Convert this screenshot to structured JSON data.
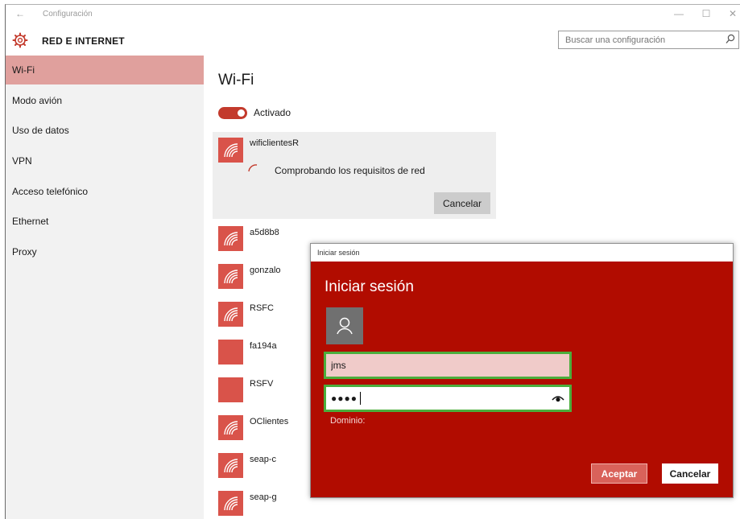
{
  "window": {
    "title": "Configuración",
    "back_glyph": "←",
    "minimize_glyph": "—",
    "maximize_glyph": "☐",
    "close_glyph": "✕"
  },
  "header": {
    "icon": "gear-icon",
    "section_title": "RED E INTERNET",
    "search": {
      "placeholder": "Buscar una configuración",
      "value": "",
      "icon": "search-icon"
    }
  },
  "sidebar": {
    "items": [
      {
        "label": "Wi-Fi",
        "selected": true
      },
      {
        "label": "Modo avión",
        "selected": false
      },
      {
        "label": "Uso de datos",
        "selected": false
      },
      {
        "label": "VPN",
        "selected": false
      },
      {
        "label": "Acceso telefónico",
        "selected": false
      },
      {
        "label": "Ethernet",
        "selected": false
      },
      {
        "label": "Proxy",
        "selected": false
      }
    ]
  },
  "main": {
    "title": "Wi-Fi",
    "toggle": {
      "label": "Activado",
      "on": true
    },
    "active_network": {
      "name": "wificlientesR",
      "status": "Comprobando los requisitos de red",
      "cancel_label": "Cancelar"
    },
    "networks": [
      {
        "name": "a5d8b8",
        "icon": "wifi-icon"
      },
      {
        "name": "gonzalo",
        "icon": "wifi-icon"
      },
      {
        "name": "RSFC",
        "icon": "wifi-icon"
      },
      {
        "name": "fa194a",
        "icon": "network-tile-icon"
      },
      {
        "name": "RSFV",
        "icon": "network-tile-icon"
      },
      {
        "name": "OClientes",
        "icon": "wifi-icon"
      },
      {
        "name": "seap-c",
        "icon": "wifi-icon"
      },
      {
        "name": "seap-g",
        "icon": "wifi-icon"
      }
    ]
  },
  "dialog": {
    "window_title": "Iniciar sesión",
    "heading": "Iniciar sesión",
    "avatar_icon": "user-icon",
    "username": {
      "value": "jms"
    },
    "password": {
      "value": "●●●●",
      "reveal_icon": "eye-icon"
    },
    "domain_label": "Dominio:",
    "accept_label": "Aceptar",
    "cancel_label": "Cancelar"
  },
  "colors": {
    "accent": "#c33a2c",
    "dialog_background": "#b10c00",
    "selected_nav": "#e0a09d",
    "highlight_frame": "#4bae3c"
  }
}
